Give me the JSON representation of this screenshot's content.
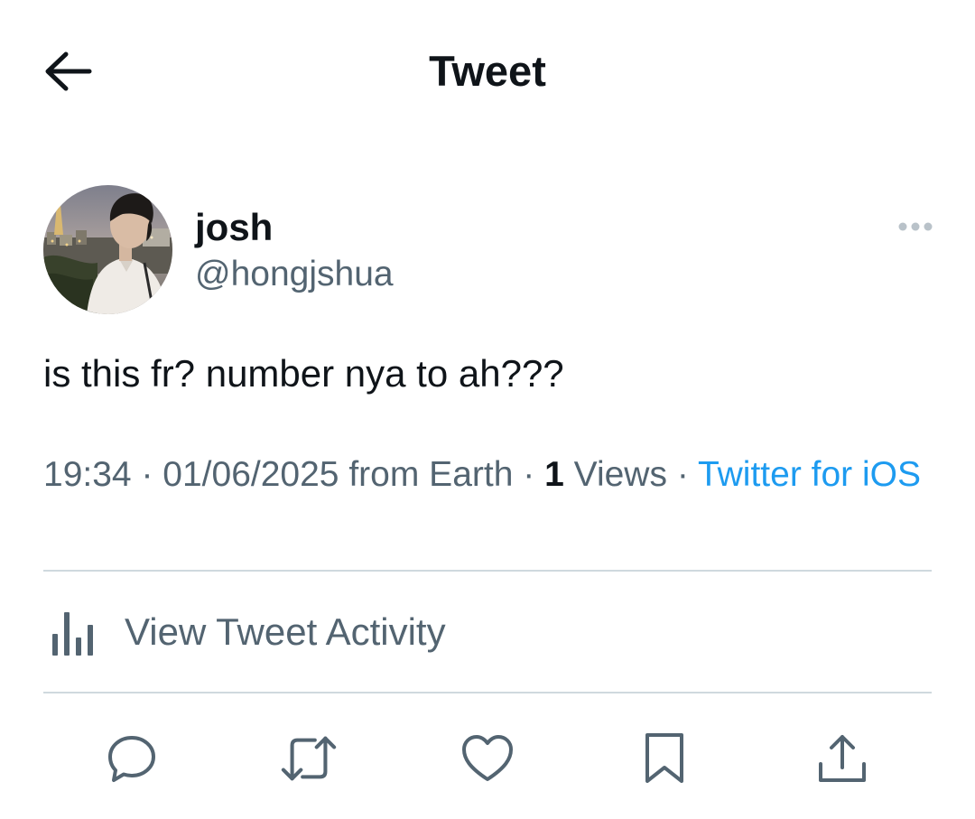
{
  "header": {
    "title": "Tweet",
    "back_icon": "arrow-left-icon"
  },
  "tweet": {
    "author": {
      "name": "josh",
      "handle": "@hongjshua",
      "avatar_icon": "profile-photo"
    },
    "more_icon": "more-horizontal-icon",
    "text": "is this fr? number nya to ah???",
    "meta": {
      "time": "19:34",
      "separator": "·",
      "date": "01/06/2025",
      "location": "from Earth",
      "views_count": "1",
      "views_label": "Views",
      "source": "Twitter for iOS"
    },
    "activity_label": "View Tweet Activity"
  },
  "actions": [
    {
      "icon": "reply-icon"
    },
    {
      "icon": "retweet-icon"
    },
    {
      "icon": "like-icon"
    },
    {
      "icon": "bookmark-icon"
    },
    {
      "icon": "share-icon"
    }
  ],
  "colors": {
    "text_primary": "#0f1419",
    "text_secondary": "#536471",
    "link": "#1d9bf0",
    "divider": "#cfd9de",
    "background": "#ffffff"
  }
}
